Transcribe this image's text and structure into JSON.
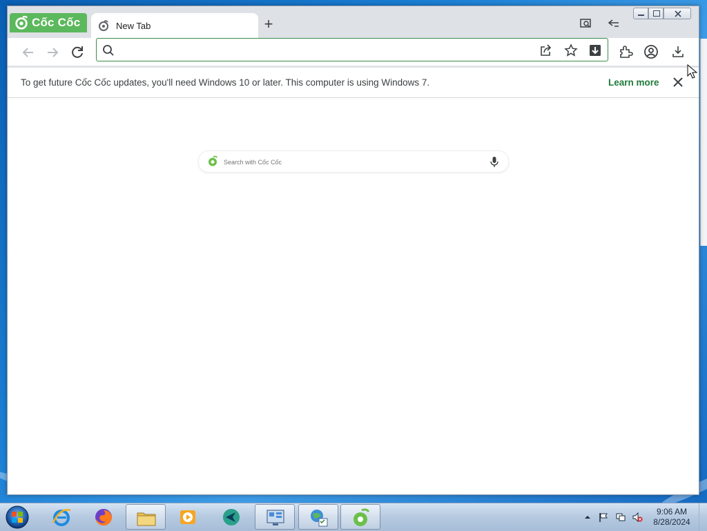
{
  "browser": {
    "brand_name": "Cốc Cốc",
    "brand_color": "#5cb85c",
    "tab": {
      "title": "New Tab"
    },
    "new_tab_symbol": "+",
    "omnibox": {
      "value": "",
      "placeholder": ""
    },
    "infobar": {
      "message": "To get future Cốc Cốc updates, you'll need Windows 10 or later. This computer is using Windows 7.",
      "link_label": "Learn more",
      "link_color": "#1f7a3a"
    },
    "ntp_search": {
      "placeholder": "Search with Cốc Cốc"
    }
  },
  "taskbar": {
    "clock_time": "9:06 AM",
    "clock_date": "8/28/2024",
    "apps": [
      "internet-explorer-icon",
      "firefox-icon",
      "file-explorer-icon",
      "media-player-icon",
      "app-icon",
      "control-panel-icon",
      "network-icon",
      "coccoc-icon"
    ]
  }
}
